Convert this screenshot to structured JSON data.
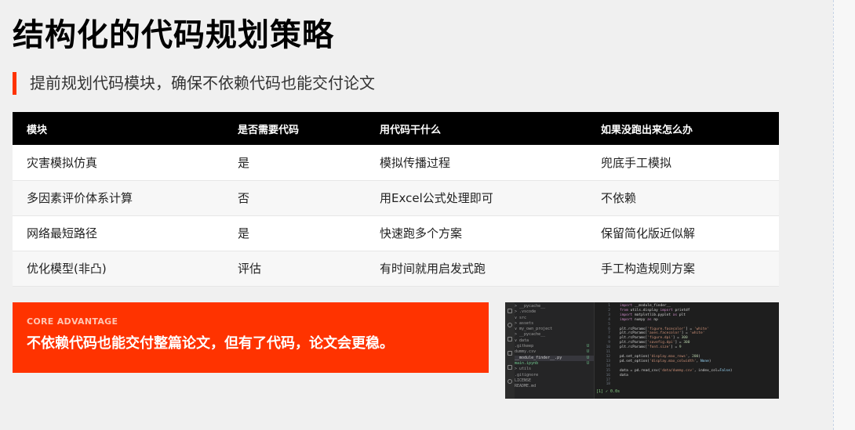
{
  "title": "结构化的代码规划策略",
  "subtitle": "提前规划代码模块，确保不依赖代码也能交付论文",
  "accent_color": "#ff3300",
  "table": {
    "headers": [
      "模块",
      "是否需要代码",
      "用代码干什么",
      "如果没跑出来怎么办"
    ],
    "rows": [
      [
        "灾害模拟仿真",
        "是",
        "模拟传播过程",
        "兜底手工模拟"
      ],
      [
        "多因素评价体系计算",
        "否",
        "用Excel公式处理即可",
        "不依赖"
      ],
      [
        "网络最短路径",
        "是",
        "快速跑多个方案",
        "保留简化版近似解"
      ],
      [
        "优化模型(非凸)",
        "评估",
        "有时间就用启发式跑",
        "手工构造规则方案"
      ]
    ]
  },
  "advantage": {
    "label": "CORE ADVANTAGE",
    "text": "不依赖代码也能交付整篇论文，但有了代码，论文会更稳。"
  },
  "code_screenshot": {
    "explorer": [
      "> __pycache__",
      "> .vscode",
      "∨ src",
      "  > assets",
      "  ∨ my_own_project",
      "    > __pycache__",
      "  ∨ data",
      "    .gitkeep",
      "    dummy.csv",
      "  __module_finder__.py",
      "  main.ipynb",
      "> utils",
      ".gitignore",
      "LICENSE",
      "README.md"
    ],
    "explorer_marks": [
      "",
      "",
      "",
      "",
      "",
      "",
      "",
      "U",
      "U",
      "U",
      "U",
      "",
      "",
      "",
      ""
    ],
    "line_numbers": [
      "1",
      "2",
      "3",
      "4",
      "5",
      "6",
      "7",
      "8",
      "9",
      "10",
      "11",
      "12",
      "13",
      "14",
      "15",
      "16",
      "17",
      "18"
    ],
    "code_lines": [
      "import __module_finder__",
      "from utils.display import printdf",
      "import matplotlib.pyplot as plt",
      "import numpy as np",
      "",
      "plt.rcParams['figure.facecolor'] = 'white'",
      "plt.rcParams['axes.facecolor'] = 'white'",
      "plt.rcParams['figure.dpi'] = 300",
      "plt.rcParams['savefig.dpi'] = 300",
      "plt.rcParams['font.size'] = 9",
      "",
      "pd.set_option('display.max_rows', 200)",
      "pd.set_option('display.max_colwidth', None)",
      "",
      "data = pd.read_csv('data/dummy.csv', index_col=False)",
      "data",
      "",
      ""
    ],
    "status": "[1]  ✓  0.0s"
  }
}
